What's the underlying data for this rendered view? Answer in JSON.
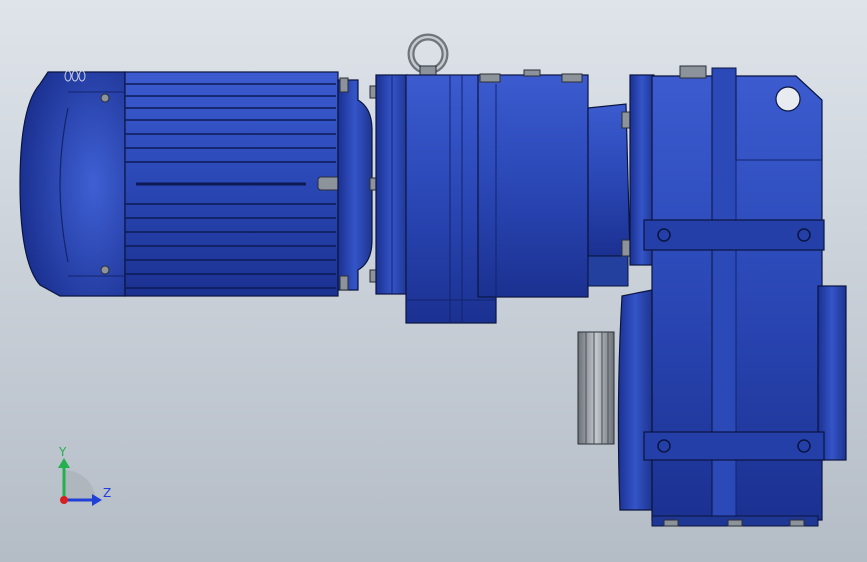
{
  "colors": {
    "body": "#2a47b5",
    "body_dark": "#1a2f88",
    "body_light": "#3f5fd0",
    "edge": "#0a1440",
    "steel": "#9aa0a8",
    "steel_dark": "#5c6168",
    "axis_y": "#22b14c",
    "axis_z": "#1f3fd6",
    "axis_origin": "#d62020"
  },
  "triad": {
    "y_label": "Y",
    "z_label": "Z"
  },
  "parts": [
    "motor-fan-cover",
    "motor-housing",
    "motor-flange",
    "primary-gear-stage",
    "lifting-eye",
    "intermediate-coupling",
    "main-gearbox-housing",
    "output-flange-disc"
  ]
}
